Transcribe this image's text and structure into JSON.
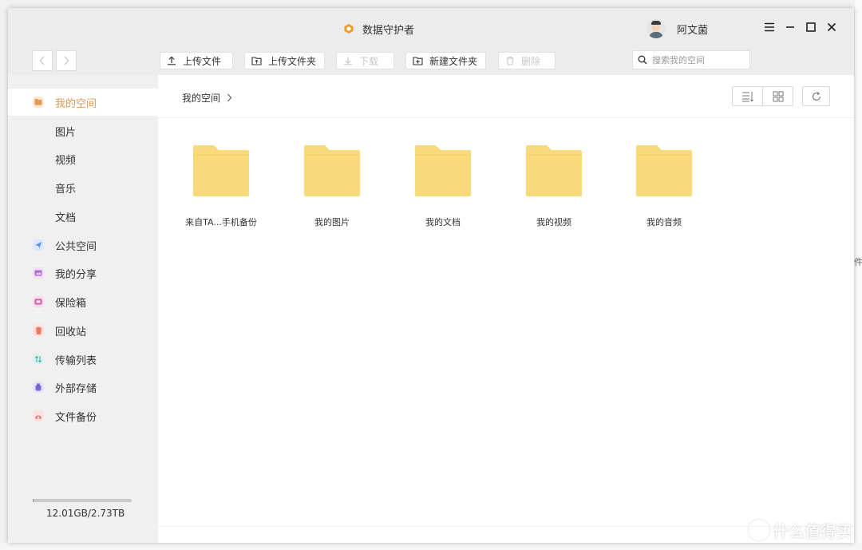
{
  "window": {
    "title": "数据守护者",
    "user_name": "阿文菌"
  },
  "toolbar": {
    "upload_file": "上传文件",
    "upload_folder": "上传文件夹",
    "download": "下载",
    "new_folder": "新建文件夹",
    "delete": "删除"
  },
  "search": {
    "placeholder": "搜索我的空间"
  },
  "sidebar": {
    "items": [
      {
        "label": "我的空间",
        "active": true
      },
      {
        "label": "图片"
      },
      {
        "label": "视频"
      },
      {
        "label": "音乐"
      },
      {
        "label": "文档"
      },
      {
        "label": "公共空间"
      },
      {
        "label": "我的分享"
      },
      {
        "label": "保险箱"
      },
      {
        "label": "回收站"
      },
      {
        "label": "传输列表"
      },
      {
        "label": "外部存储"
      },
      {
        "label": "文件备份"
      }
    ],
    "storage_text": "12.01GB/2.73TB",
    "storage_used_fraction": 0.0043
  },
  "breadcrumb": {
    "current": "我的空间"
  },
  "folders": [
    {
      "name": "来自TA...手机备份"
    },
    {
      "name": "我的图片"
    },
    {
      "name": "我的文档"
    },
    {
      "name": "我的视频"
    },
    {
      "name": "我的音频"
    }
  ],
  "background": {
    "edge_text": "件,",
    "watermark": "什么值得买"
  },
  "colors": {
    "accent": "#e29a55",
    "folder": "#f9da7b",
    "disabled": "#c7c7c7"
  }
}
